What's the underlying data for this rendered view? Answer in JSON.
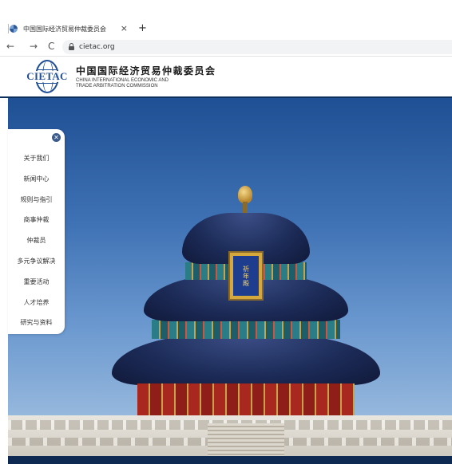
{
  "browser": {
    "tab_title": "中国国际经济贸易仲裁委员会",
    "tab_close": "×",
    "new_tab": "+",
    "back": "←",
    "forward": "→",
    "reload": "C",
    "url": "cietac.org"
  },
  "header": {
    "logo_text": "CIETAC",
    "org_name_cn": "中国国际经济贸易仲裁委员会",
    "org_name_en_line1": "CHINA INTERNATIONAL ECONOMIC AND",
    "org_name_en_line2": "TRADE ARBITRATION COMMISSION"
  },
  "hero": {
    "plaque_text": "祈年殿"
  },
  "side_menu": {
    "close_icon": "close-icon",
    "items": [
      {
        "label": "关于我们"
      },
      {
        "label": "新闻中心"
      },
      {
        "label": "规则与指引"
      },
      {
        "label": "商事仲裁"
      },
      {
        "label": "仲裁员"
      },
      {
        "label": "多元争议解决"
      },
      {
        "label": "重要活动"
      },
      {
        "label": "人才培养"
      },
      {
        "label": "研究与资料"
      }
    ]
  },
  "colors": {
    "brand_blue": "#1f4e96",
    "header_rule": "#0d2f5c",
    "sky_top": "#1f4f94"
  }
}
